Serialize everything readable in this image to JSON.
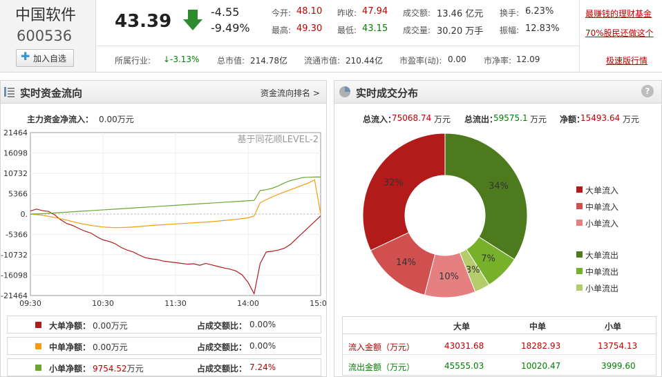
{
  "stock": {
    "name": "中国软件",
    "code": "600536",
    "add_label": "加入自选",
    "price": "43.39",
    "change": "-4.55",
    "change_pct": "-9.49%"
  },
  "quote": {
    "open_label": "今开:",
    "open": "48.10",
    "prev_label": "昨收:",
    "prev": "47.94",
    "amount_label": "成交额:",
    "amount": "13.46 亿元",
    "turnover_label": "换手:",
    "turnover": "6.23%",
    "high_label": "最高:",
    "high": "49.30",
    "low_label": "最低:",
    "low": "43.15",
    "volume_label": "成交量:",
    "volume": "30.20 万手",
    "amplitude_label": "振幅:",
    "amplitude": "12.83%"
  },
  "stats": {
    "industry_label": "所属行业:",
    "industry": "-3.13%",
    "industry_arrow": "↓",
    "mcap_label": "总市值:",
    "mcap": "214.78亿",
    "float_label": "流通市值:",
    "float": "210.44亿",
    "pe_label": "市盈率(动):",
    "pe": "0.00",
    "pb_label": "市净率:",
    "pb": "12.09"
  },
  "ads": {
    "link1": "最赚钱的理财基金",
    "link2": "70%股民还做这个",
    "link3": "极速版行情"
  },
  "left_panel": {
    "title": "实时资金流向",
    "rank_link": "资金流向排名 >",
    "net_inflow_label": "主力资金净流入：",
    "net_inflow_value": "0.00万元",
    "watermark": "基于同花顺LEVEL-2",
    "legend": [
      {
        "label": "大单净额：",
        "value": "0.00",
        "unit": "万元",
        "ratio_label": "占成交额比：",
        "ratio": "0.00%",
        "color": "#b31b1b"
      },
      {
        "label": "中单净额：",
        "value": "0.00",
        "unit": "万元",
        "ratio_label": "占成交额比：",
        "ratio": "0.00%",
        "color": "#f39c12"
      },
      {
        "label": "小单净额：",
        "value": "9754.52",
        "unit": "万元",
        "ratio_label": "占成交额比：",
        "ratio": "7.24%",
        "color": "#6aa62f"
      }
    ]
  },
  "chart_data": [
    {
      "type": "line",
      "title": "",
      "y_ticks": [
        "21464",
        "16098",
        "10732",
        "5366",
        "0.",
        "-5366",
        "-10732",
        "-16098",
        "-21464"
      ],
      "x_ticks": [
        "09:30",
        "10:30",
        "11:30",
        "14:00",
        "15:00"
      ],
      "ylim": [
        -21464,
        21464
      ],
      "series": [
        {
          "color": "#b31b1b",
          "x": [
            0,
            5,
            10,
            15,
            20,
            25,
            30,
            35,
            40,
            45,
            50,
            55,
            60,
            65,
            70,
            75,
            80,
            85,
            90,
            95,
            100,
            105,
            110,
            115,
            120,
            125,
            130,
            135,
            140,
            145,
            150,
            155,
            160,
            165,
            170,
            175,
            180,
            185,
            190,
            195,
            200,
            205,
            210,
            215,
            220,
            225,
            230,
            235,
            240
          ],
          "y": [
            800,
            1300,
            900,
            700,
            -200,
            -1500,
            -2500,
            -3000,
            -3800,
            -4500,
            -5000,
            -6000,
            -6800,
            -7200,
            -7800,
            -8800,
            -9500,
            -10000,
            -10800,
            -11500,
            -11800,
            -12000,
            -12400,
            -12600,
            -12800,
            -13000,
            -13200,
            -13100,
            -13500,
            -13000,
            -13400,
            -13800,
            -14200,
            -14500,
            -15000,
            -16000,
            -18000,
            -21000,
            -13000,
            -10000,
            -9800,
            -9500,
            -9000,
            -8000,
            -6500,
            -5000,
            -3500,
            -2000,
            -500
          ]
        },
        {
          "color": "#f39c12",
          "x": [
            0,
            10,
            20,
            30,
            40,
            50,
            60,
            70,
            80,
            90,
            100,
            110,
            120,
            130,
            140,
            150,
            160,
            170,
            180,
            185,
            190,
            195,
            200,
            205,
            210,
            215,
            220,
            225,
            230,
            235,
            240
          ],
          "y": [
            0,
            -300,
            -900,
            -1600,
            -2400,
            -3000,
            -3400,
            -3600,
            -3500,
            -3300,
            -3000,
            -2800,
            -2600,
            -2400,
            -2200,
            -2000,
            -1700,
            -1400,
            -1000,
            -500,
            3000,
            3800,
            4500,
            5200,
            5800,
            6400,
            7000,
            7600,
            8200,
            9000,
            0
          ]
        },
        {
          "color": "#6aa62f",
          "x": [
            0,
            10,
            20,
            30,
            40,
            50,
            60,
            70,
            80,
            90,
            100,
            110,
            120,
            130,
            140,
            150,
            160,
            170,
            180,
            185,
            190,
            195,
            200,
            205,
            210,
            215,
            220,
            225,
            230,
            235,
            240
          ],
          "y": [
            0,
            100,
            300,
            500,
            700,
            900,
            1100,
            1300,
            1500,
            1700,
            1900,
            2100,
            2300,
            2500,
            2700,
            2900,
            3100,
            3300,
            3500,
            3600,
            6200,
            6400,
            6800,
            7400,
            8200,
            8800,
            9200,
            9600,
            9700,
            9754,
            9754
          ]
        }
      ]
    },
    {
      "type": "pie",
      "title": "",
      "categories": [
        "大单流入",
        "中单流入",
        "小单流入",
        "大单流出",
        "中单流出",
        "小单流出"
      ],
      "values": [
        32,
        14,
        10,
        34,
        7,
        3
      ],
      "labels": [
        "32%",
        "14%",
        "10%",
        "34%",
        "7%",
        "3%"
      ],
      "colors": [
        "#b31b1b",
        "#d05050",
        "#e68080",
        "#4e7a1e",
        "#77b02a",
        "#b5cc6a"
      ]
    }
  ],
  "right_panel": {
    "title": "实时成交分布",
    "help": "?",
    "total_in_label": "总流入：",
    "total_in": "75068.74",
    "total_in_unit": "万元",
    "total_out_label": "总流出：",
    "total_out": "59575.1",
    "total_out_unit": "万元",
    "net_label": "净额：",
    "net": "15493.64",
    "net_unit": "万元",
    "legend": [
      "大单流入",
      "中单流入",
      "小单流入",
      "大单流出",
      "中单流出",
      "小单流出"
    ],
    "table": {
      "headers": [
        "大单",
        "中单",
        "小单"
      ],
      "rows": [
        {
          "label": "流入金额（万元）",
          "values": [
            "43031.68",
            "18282.93",
            "13754.13"
          ]
        },
        {
          "label": "流出金额（万元）",
          "values": [
            "45555.03",
            "10020.47",
            "3999.60"
          ]
        }
      ]
    }
  }
}
